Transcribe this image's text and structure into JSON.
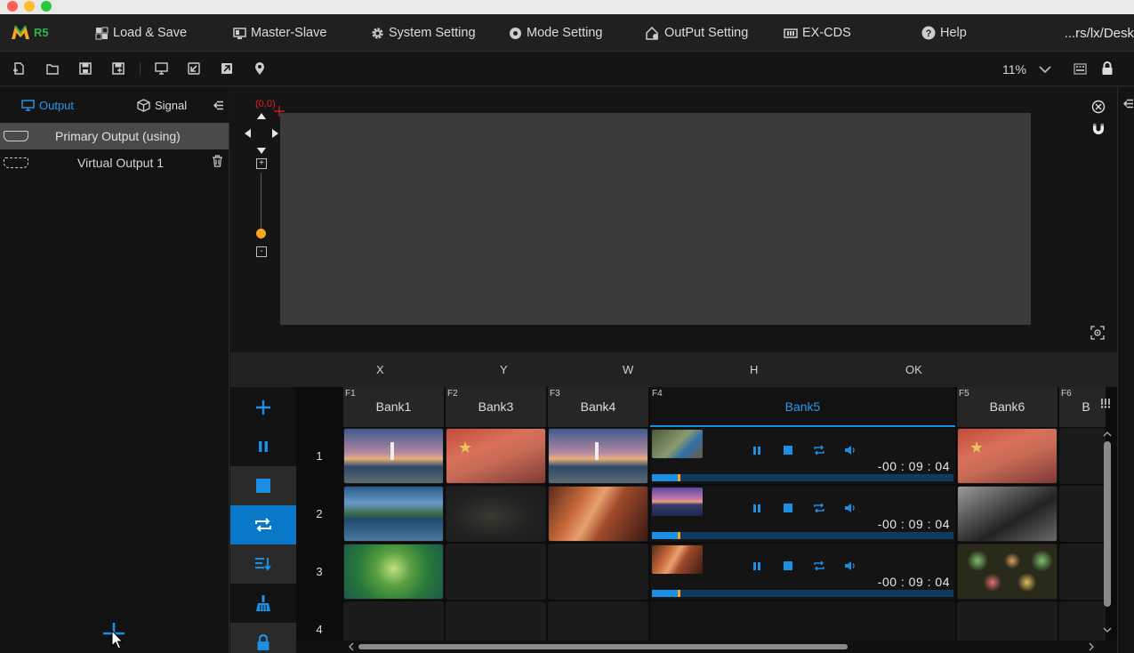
{
  "app": {
    "logo_text": "R5",
    "path": "...rs/lx/Desk"
  },
  "menu": [
    {
      "label": "Load & Save",
      "icon": "load-save-icon"
    },
    {
      "label": "Master-Slave",
      "icon": "master-slave-icon"
    },
    {
      "label": "System Setting",
      "icon": "gear-icon"
    },
    {
      "label": "Mode Setting",
      "icon": "mode-icon"
    },
    {
      "label": "OutPut Setting",
      "icon": "output-setting-icon"
    },
    {
      "label": "EX-CDS",
      "icon": "ex-cds-icon"
    },
    {
      "label": "Help",
      "icon": "help-icon"
    }
  ],
  "toolbar": {
    "zoom": "11%"
  },
  "left_panel": {
    "tabs": {
      "output": "Output",
      "signal": "Signal"
    },
    "outputs": [
      {
        "label": "Primary Output (using)",
        "selected": true
      },
      {
        "label": "Virtual Output 1",
        "selected": false
      }
    ]
  },
  "canvas": {
    "origin": "(0,0)",
    "slider_level": 0.0
  },
  "coord_bar": {
    "x": "X",
    "y": "Y",
    "w": "W",
    "h": "H",
    "ok": "OK"
  },
  "banks": [
    {
      "fn": "F1",
      "name": "Bank1",
      "active": false
    },
    {
      "fn": "F2",
      "name": "Bank3",
      "active": false
    },
    {
      "fn": "F3",
      "name": "Bank4",
      "active": false
    },
    {
      "fn": "F4",
      "name": "Bank5",
      "active": true
    },
    {
      "fn": "F5",
      "name": "Bank6",
      "active": false
    },
    {
      "fn": "F6",
      "name": "B",
      "active": false
    }
  ],
  "rows": [
    "1",
    "2",
    "3",
    "4"
  ],
  "players": [
    {
      "time": "-00 : 09 : 04",
      "progress": 0.09
    },
    {
      "time": "-00 : 09 : 04",
      "progress": 0.09
    },
    {
      "time": "-00 : 09 : 04",
      "progress": 0.09
    }
  ],
  "colors": {
    "accent": "#1a8fe3",
    "brand_green": "#31b24b",
    "marker": "#f5a623",
    "origin_red": "#e02020"
  }
}
